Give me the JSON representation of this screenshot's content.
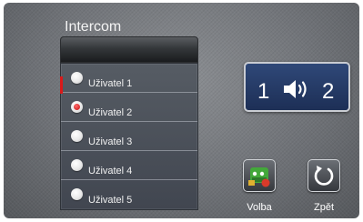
{
  "header": {
    "title": "Intercom"
  },
  "users": [
    {
      "label": "Uživatel 1",
      "selected": false
    },
    {
      "label": "Uživatel 2",
      "selected": true
    },
    {
      "label": "Uživatel 3",
      "selected": false
    },
    {
      "label": "Uživatel 4",
      "selected": false
    },
    {
      "label": "Uživatel 5",
      "selected": false
    }
  ],
  "line": {
    "from": "1",
    "to": "2",
    "icon": "speaker-icon"
  },
  "buttons": {
    "volba": {
      "label": "Volba",
      "icon": "apps-icon"
    },
    "zpet": {
      "label": "Zpět",
      "icon": "refresh-back-icon"
    }
  },
  "colors": {
    "accent_red": "#d91919",
    "line_box": "#23386a"
  }
}
